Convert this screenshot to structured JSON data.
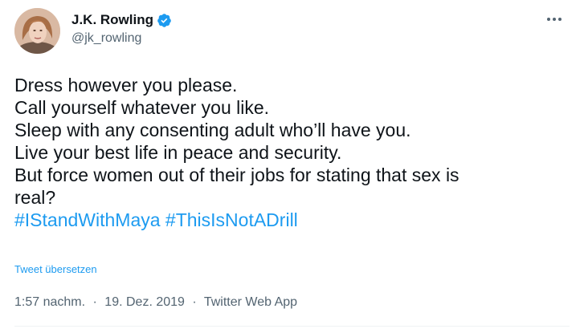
{
  "author": {
    "display_name": "J.K. Rowling",
    "handle": "@jk_rowling",
    "verified": true
  },
  "tweet": {
    "lines": [
      "Dress however you please.",
      "Call yourself whatever you like.",
      "Sleep with any consenting adult who’ll have you.",
      "Live your best life in peace and security.",
      "But force women out of their jobs for stating that sex is",
      "real?"
    ],
    "hashtags": [
      "#IStandWithMaya",
      "#ThisIsNotADrill"
    ],
    "translate_label": "Tweet übersetzen",
    "time": "1:57 nachm.",
    "separator": "·",
    "date": "19. Dez. 2019",
    "source": "Twitter Web App"
  },
  "icons": {
    "verified": "verified-badge-icon",
    "more": "more-horizontal-icon"
  },
  "colors": {
    "link": "#1d9bf0",
    "text": "#0f1419",
    "secondary": "#536471"
  }
}
